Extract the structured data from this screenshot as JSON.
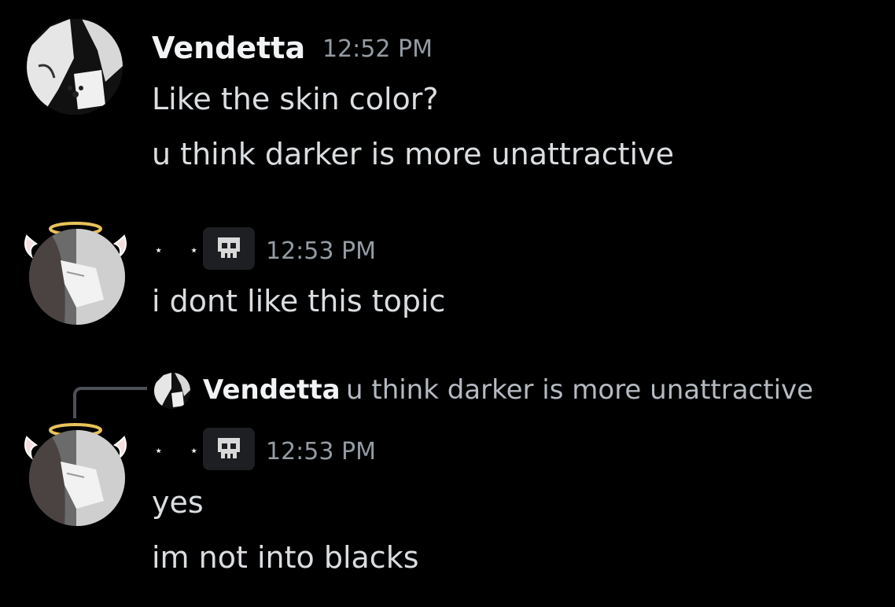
{
  "messages": [
    {
      "author": "Vendetta",
      "time": "12:52 PM",
      "lines": [
        "Like the skin color?",
        "u think darker is more unattractive"
      ]
    },
    {
      "author_decoration": "⋆ ⋆",
      "time": "12:53 PM",
      "lines": [
        "i dont like this topic"
      ]
    },
    {
      "reply_to": {
        "author": "Vendetta",
        "text": "u think darker is more unattractive"
      },
      "author_decoration": "⋆ ⋆",
      "time": "12:53 PM",
      "lines": [
        "yes",
        "im not into blacks"
      ]
    }
  ],
  "icons": {
    "role_tag": "skull-icon",
    "avatar_decoration": "halo-wings"
  },
  "colors": {
    "background": "#000000",
    "username": "#f2f3f5",
    "message": "#dbdee1",
    "timestamp": "#949ba4",
    "halo": "#e8c35a"
  }
}
